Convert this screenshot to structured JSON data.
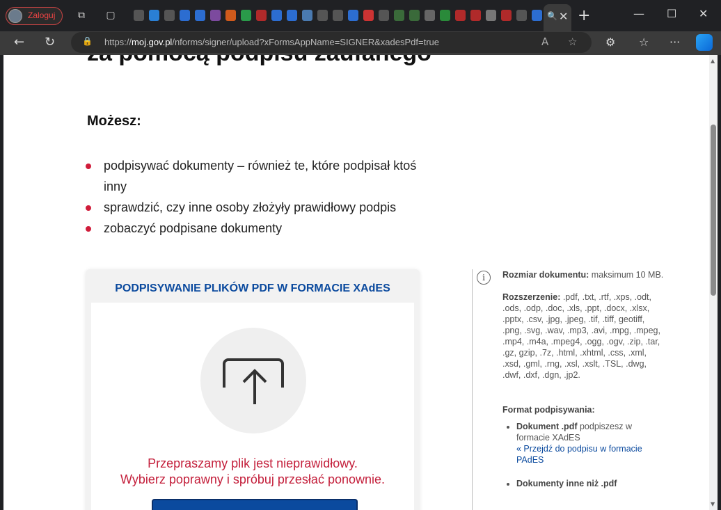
{
  "browser": {
    "profile_label": "Zaloguj",
    "url_domain": "moj.gov.pl",
    "url_prefix": "https://",
    "url_rest": "/nforms/signer/upload?xFormsAppName=SIGNER&xadesPdf=true",
    "accent": "#0b4a9e"
  },
  "page": {
    "heading": "za pomocą podpisu zaufanego",
    "intro_label": "Możesz:",
    "bullets": [
      "podpisywać dokumenty – również te, które podpisał ktoś inny",
      "sprawdzić, czy inne osoby złożyły prawidłowy podpis",
      "zobaczyć podpisane dokumenty"
    ],
    "card": {
      "title": "PODPISYWANIE PLIKÓW PDF W FORMACIE XAdES",
      "error_line1": "Przepraszamy plik jest nieprawidłowy.",
      "error_line2": "Wybierz poprawny i spróbuj przesłać ponownie."
    },
    "sidebar": {
      "size_label": "Rozmiar dokumentu:",
      "size_value": " maksimum 10 MB.",
      "ext_label": "Rozszerzenie:",
      "ext_value": " .pdf, .txt, .rtf, .xps, .odt, .ods, .odp, .doc, .xls, .ppt, .docx, .xlsx, .pptx, .csv, .jpg, .jpeg, .tif, .tiff, geotiff, .png, .svg, .wav, .mp3, .avi, .mpg, .mpeg, .mp4, .m4a, .mpeg4, .ogg, .ogv, .zip, .tar, .gz, gzip, .7z, .html, .xhtml, .css, .xml, .xsd, .gml, .rng, .xsl, .xslt, .TSL, .dwg, .dwf, .dxf, .dgn, .jp2.",
      "format_label": "Format podpisywania:",
      "item1_bold": "Dokument .pdf",
      "item1_text": " podpiszesz w formacie XAdES",
      "item1_link": "« Przejdź do podpisu w formacie PAdES",
      "item2_bold": "Dokumenty inne niż .pdf"
    }
  }
}
